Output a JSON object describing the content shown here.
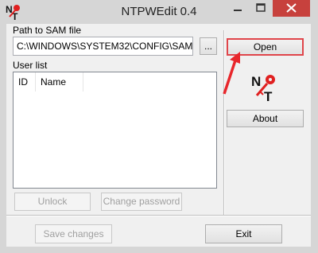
{
  "window": {
    "title": "NTPWEdit 0.4"
  },
  "sam": {
    "label": "Path to SAM file",
    "path": "C:\\WINDOWS\\SYSTEM32\\CONFIG\\SAM",
    "browse_label": "..."
  },
  "buttons": {
    "open": "Open",
    "about": "About",
    "unlock": "Unlock",
    "change_password": "Change password",
    "save_changes": "Save changes",
    "exit": "Exit"
  },
  "user_list": {
    "label": "User list",
    "columns": [
      "ID",
      "Name"
    ]
  },
  "logo": {
    "text_n": "N",
    "text_t": "T"
  },
  "colors": {
    "highlight": "#e0454a",
    "arrow": "#e8262b",
    "close": "#c7413d"
  },
  "icons": [
    "app-icon",
    "minimize-icon",
    "maximize-icon",
    "close-icon",
    "ntpwedit-logo-icon",
    "annotation-arrow"
  ]
}
